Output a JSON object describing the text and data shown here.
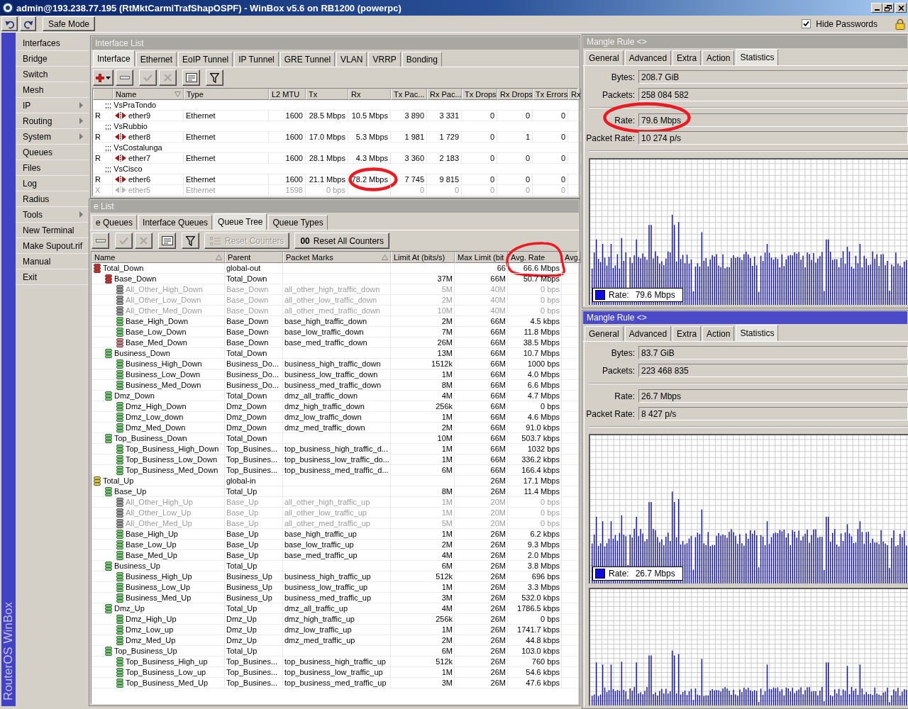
{
  "window": {
    "title": "admin@193.238.77.195 (RtMktCarmiTrafShapOSPF) - WinBox v5.6 on RB1200 (powerpc)"
  },
  "toolbar": {
    "safe_mode": "Safe Mode",
    "hide_passwords": {
      "label": "Hide Passwords",
      "checked": true
    }
  },
  "brand": "RouterOS WinBox",
  "sidebar": {
    "items": [
      {
        "label": "Interfaces",
        "submenu": false
      },
      {
        "label": "Bridge",
        "submenu": false
      },
      {
        "label": "Switch",
        "submenu": false
      },
      {
        "label": "Mesh",
        "submenu": false
      },
      {
        "label": "IP",
        "submenu": true
      },
      {
        "label": "Routing",
        "submenu": true
      },
      {
        "label": "System",
        "submenu": true
      },
      {
        "label": "Queues",
        "submenu": false
      },
      {
        "label": "Files",
        "submenu": false
      },
      {
        "label": "Log",
        "submenu": false
      },
      {
        "label": "Radius",
        "submenu": false
      },
      {
        "label": "Tools",
        "submenu": true
      },
      {
        "label": "New Terminal",
        "submenu": false
      },
      {
        "label": "Make Supout.rif",
        "submenu": false
      },
      {
        "label": "Manual",
        "submenu": false
      },
      {
        "label": "Exit",
        "submenu": false
      }
    ]
  },
  "interface_list": {
    "title": "Interface List",
    "tabs": [
      {
        "label": "Interface",
        "selected": true
      },
      {
        "label": "Ethernet",
        "selected": false
      },
      {
        "label": "EoIP Tunnel",
        "selected": false
      },
      {
        "label": "IP Tunnel",
        "selected": false
      },
      {
        "label": "GRE Tunnel",
        "selected": false
      },
      {
        "label": "VLAN",
        "selected": false
      },
      {
        "label": "VRRP",
        "selected": false
      },
      {
        "label": "Bonding",
        "selected": false
      }
    ],
    "tools": [
      {
        "kind": "add",
        "disabled": false
      },
      {
        "kind": "remove",
        "disabled": false
      },
      {
        "kind": "enable",
        "disabled": true
      },
      {
        "kind": "disable",
        "disabled": true
      },
      {
        "kind": "comment",
        "disabled": false
      },
      {
        "kind": "filter",
        "disabled": false
      }
    ],
    "columns": [
      {
        "label": "Name",
        "sorted": true,
        "descending": true
      },
      {
        "label": "Type"
      },
      {
        "label": "L2 MTU"
      },
      {
        "label": "Tx"
      },
      {
        "label": "Rx"
      },
      {
        "label": "Tx Pac..."
      },
      {
        "label": "Rx Pac..."
      },
      {
        "label": "Tx Drops"
      },
      {
        "label": "Rx Drops"
      },
      {
        "label": "Tx Errors"
      },
      {
        "label": "Rx"
      }
    ],
    "rows": [
      {
        "kind": "comment",
        "text": ";;; VsPraTondo"
      },
      {
        "kind": "interface",
        "flag": "R",
        "name": "ether9",
        "type": "Ethernet",
        "l2_mtu": "1600",
        "tx": "28.5 Mbps",
        "rx": "10.5 Mbps",
        "tx_packets": "3 890",
        "rx_packets": "3 331",
        "tx_drops": "0",
        "rx_drops": "0",
        "tx_errors": "0",
        "disabled": false
      },
      {
        "kind": "comment",
        "text": ";;; VsRubbio"
      },
      {
        "kind": "interface",
        "flag": "R",
        "name": "ether8",
        "type": "Ethernet",
        "l2_mtu": "1600",
        "tx": "17.0 Mbps",
        "rx": "5.3 Mbps",
        "tx_packets": "1 981",
        "rx_packets": "1 729",
        "tx_drops": "0",
        "rx_drops": "1",
        "tx_errors": "0",
        "disabled": false
      },
      {
        "kind": "comment",
        "text": ";;; VsCostalunga"
      },
      {
        "kind": "interface",
        "flag": "R",
        "name": "ether7",
        "type": "Ethernet",
        "l2_mtu": "1600",
        "tx": "28.1 Mbps",
        "rx": "4.3 Mbps",
        "tx_packets": "3 360",
        "rx_packets": "2 183",
        "tx_drops": "0",
        "rx_drops": "0",
        "tx_errors": "0",
        "disabled": false
      },
      {
        "kind": "comment",
        "text": ";;; VsCisco"
      },
      {
        "kind": "interface",
        "flag": "R",
        "name": "ether6",
        "type": "Ethernet",
        "l2_mtu": "1600",
        "tx": "21.1 Mbps",
        "rx": "78.2 Mbps",
        "tx_packets": "7 745",
        "rx_packets": "9 815",
        "tx_drops": "0",
        "rx_drops": "0",
        "tx_errors": "0",
        "disabled": false,
        "circled": true
      },
      {
        "kind": "interface",
        "flag": "X",
        "name": "ether5",
        "type": "Ethernet",
        "l2_mtu": "1598",
        "tx": "0 bps",
        "tx_packets": "0",
        "rx_packets": "0",
        "tx_drops": "0",
        "rx_drops": "0",
        "tx_errors": "0",
        "disabled": true
      }
    ]
  },
  "queue_list": {
    "title": "e List",
    "tabs": [
      {
        "label": "e Queues",
        "selected": false
      },
      {
        "label": "Interface Queues",
        "selected": false
      },
      {
        "label": "Queue Tree",
        "selected": true
      },
      {
        "label": "Queue Types",
        "selected": false
      }
    ],
    "tools": [
      {
        "kind": "remove",
        "disabled": false
      },
      {
        "kind": "enable",
        "disabled": true
      },
      {
        "kind": "disable",
        "disabled": true
      },
      {
        "kind": "comment",
        "disabled": false
      },
      {
        "kind": "filter",
        "disabled": false
      }
    ],
    "buttons": [
      {
        "kind": "reset_counters",
        "label": "Reset Counters",
        "disabled": true
      },
      {
        "kind": "reset_all_counters",
        "icon_text": "00",
        "label": "Reset All Counters",
        "disabled": false
      }
    ],
    "columns": [
      {
        "label": "Name",
        "sorted": true,
        "descending": false
      },
      {
        "label": "Parent"
      },
      {
        "label": "Packet Marks",
        "sorted": true,
        "descending": false
      },
      {
        "label": "Limit At (bits/s)"
      },
      {
        "label": "Max Limit (bit"
      },
      {
        "label": "Avg. Rate",
        "circled": true
      },
      {
        "label": "Avg."
      }
    ],
    "rows": [
      {
        "name": "Total_Down",
        "parent": "global-out",
        "max_limit": "66",
        "avg_rate": "66.6 Mbps",
        "color": "#e02828",
        "disabled": false,
        "children": [
          {
            "name": "Base_Down",
            "parent": "Total_Down",
            "limit_at": "37M",
            "max_limit": "66M",
            "avg_rate": "50.7 Mbps",
            "color": "#e02828",
            "disabled": false,
            "children": [
              {
                "name": "All_Other_High_Down",
                "parent": "Base_Down",
                "packet_marks": "all_other_high_traffic_down",
                "limit_at": "5M",
                "max_limit": "40M",
                "avg_rate": "0 bps",
                "color": "#a0a0a0",
                "disabled": true
              },
              {
                "name": "All_Other_Low_Down",
                "parent": "Base_Down",
                "packet_marks": "all_other_low_traffic_down",
                "limit_at": "2M",
                "max_limit": "40M",
                "avg_rate": "0 bps",
                "color": "#a0a0a0",
                "disabled": true
              },
              {
                "name": "All_Other_Med_Down",
                "parent": "Base_Down",
                "packet_marks": "all_other_med_traffic_down",
                "limit_at": "10M",
                "max_limit": "40M",
                "avg_rate": "0 bps",
                "color": "#a0a0a0",
                "disabled": true
              },
              {
                "name": "Base_High_Down",
                "parent": "Base_Down",
                "packet_marks": "base_high_traffic_down",
                "limit_at": "2M",
                "max_limit": "66M",
                "avg_rate": "4.5 kbps",
                "color": "#6cd86c",
                "disabled": false
              },
              {
                "name": "Base_Low_Down",
                "parent": "Base_Down",
                "packet_marks": "base_low_traffic_down",
                "limit_at": "7M",
                "max_limit": "66M",
                "avg_rate": "11.8 Mbps",
                "color": "#6cd86c",
                "disabled": false
              },
              {
                "name": "Base_Med_Down",
                "parent": "Base_Down",
                "packet_marks": "base_med_traffic_down",
                "limit_at": "26M",
                "max_limit": "66M",
                "avg_rate": "38.5 Mbps",
                "color": "#d88a8a",
                "disabled": false
              }
            ]
          },
          {
            "name": "Business_Down",
            "parent": "Total_Down",
            "limit_at": "13M",
            "max_limit": "66M",
            "avg_rate": "10.7 Mbps",
            "color": "#6cd86c",
            "disabled": false,
            "children": [
              {
                "name": "Business_High_Down",
                "parent": "Business_Do...",
                "packet_marks": "business_high_traffic_down",
                "limit_at": "1512k",
                "max_limit": "66M",
                "avg_rate": "1000 bps",
                "color": "#6cd86c",
                "disabled": false
              },
              {
                "name": "Business_Low_Down",
                "parent": "Business_Do...",
                "packet_marks": "business_low_traffic_down",
                "limit_at": "1M",
                "max_limit": "66M",
                "avg_rate": "4.0 Mbps",
                "color": "#6cd86c",
                "disabled": false
              },
              {
                "name": "Business_Med_Down",
                "parent": "Business_Do...",
                "packet_marks": "business_med_traffic_down",
                "limit_at": "8M",
                "max_limit": "66M",
                "avg_rate": "6.6 Mbps",
                "color": "#6cd86c",
                "disabled": false
              }
            ]
          },
          {
            "name": "Dmz_Down",
            "parent": "Total_Down",
            "packet_marks": "dmz_all_traffic_down",
            "limit_at": "4M",
            "max_limit": "66M",
            "avg_rate": "4.7 Mbps",
            "color": "#6cd86c",
            "disabled": false,
            "children": [
              {
                "name": "Dmz_High_Down",
                "parent": "Dmz_Down",
                "packet_marks": "dmz_high_traffic_down",
                "limit_at": "256k",
                "max_limit": "66M",
                "avg_rate": "0 bps",
                "color": "#6cd86c",
                "disabled": false
              },
              {
                "name": "Dmz_Low_down",
                "parent": "Dmz_Down",
                "packet_marks": "dmz_low_traffic_down",
                "limit_at": "1M",
                "max_limit": "66M",
                "avg_rate": "4.6 Mbps",
                "color": "#6cd86c",
                "disabled": false
              },
              {
                "name": "Dmz_Med_Down",
                "parent": "Dmz_Down",
                "packet_marks": "dmz_med_traffic_down",
                "limit_at": "2M",
                "max_limit": "66M",
                "avg_rate": "91.0 kbps",
                "color": "#6cd86c",
                "disabled": false
              }
            ]
          },
          {
            "name": "Top_Business_Down",
            "parent": "Total_Down",
            "limit_at": "10M",
            "max_limit": "66M",
            "avg_rate": "503.7 kbps",
            "color": "#6cd86c",
            "disabled": false,
            "children": [
              {
                "name": "Top_Business_High_Down",
                "parent": "Top_Busines...",
                "packet_marks": "top_business_high_traffic_d...",
                "limit_at": "1M",
                "max_limit": "66M",
                "avg_rate": "1032 bps",
                "color": "#6cd86c",
                "disabled": false
              },
              {
                "name": "Top_Business_Low_Down",
                "parent": "Top_Busines...",
                "packet_marks": "top_business_low_traffic_do...",
                "limit_at": "1M",
                "max_limit": "66M",
                "avg_rate": "336.2 kbps",
                "color": "#6cd86c",
                "disabled": false
              },
              {
                "name": "Top_Business_Med_Down",
                "parent": "Top_Busines...",
                "packet_marks": "top_business_med_traffic_d...",
                "limit_at": "6M",
                "max_limit": "66M",
                "avg_rate": "166.4 kbps",
                "color": "#6cd86c",
                "disabled": false
              }
            ]
          }
        ]
      },
      {
        "name": "Total_Up",
        "parent": "global-in",
        "max_limit": "26M",
        "avg_rate": "17.1 Mbps",
        "color": "#e8d23c",
        "disabled": false,
        "children": [
          {
            "name": "Base_Up",
            "parent": "Total_Up",
            "limit_at": "8M",
            "max_limit": "26M",
            "avg_rate": "11.4 Mbps",
            "color": "#6cd86c",
            "disabled": false,
            "children": [
              {
                "name": "All_Other_High_Up",
                "parent": "Base_Up",
                "packet_marks": "all_other_high_traffic_up",
                "limit_at": "1M",
                "max_limit": "20M",
                "avg_rate": "0 bps",
                "color": "#a0a0a0",
                "disabled": true
              },
              {
                "name": "All_Other_Low_Up",
                "parent": "Base_Up",
                "packet_marks": "all_other_low_traffic_up",
                "limit_at": "1M",
                "max_limit": "20M",
                "avg_rate": "0 bps",
                "color": "#a0a0a0",
                "disabled": true
              },
              {
                "name": "All_Other_Med_Up",
                "parent": "Base_Up",
                "packet_marks": "all_other_med_traffic_up",
                "limit_at": "5M",
                "max_limit": "20M",
                "avg_rate": "0 bps",
                "color": "#a0a0a0",
                "disabled": true
              },
              {
                "name": "Base_High_Up",
                "parent": "Base_Up",
                "packet_marks": "base_high_traffic_up",
                "limit_at": "1M",
                "max_limit": "26M",
                "avg_rate": "6.2 kbps",
                "color": "#6cd86c",
                "disabled": false
              },
              {
                "name": "Base_Low_Up",
                "parent": "Base_Up",
                "packet_marks": "base_low_traffic_up",
                "limit_at": "2M",
                "max_limit": "26M",
                "avg_rate": "9.3 Mbps",
                "color": "#6cd86c",
                "disabled": false
              },
              {
                "name": "Base_Med_Up",
                "parent": "Base_Up",
                "packet_marks": "base_med_traffic_up",
                "limit_at": "4M",
                "max_limit": "26M",
                "avg_rate": "2.0 Mbps",
                "color": "#6cd86c",
                "disabled": false
              }
            ]
          },
          {
            "name": "Business_Up",
            "parent": "Total_Up",
            "limit_at": "6M",
            "max_limit": "26M",
            "avg_rate": "3.8 Mbps",
            "color": "#6cd86c",
            "disabled": false,
            "children": [
              {
                "name": "Business_High_Up",
                "parent": "Business_Up",
                "packet_marks": "business_high_traffic_up",
                "limit_at": "512k",
                "max_limit": "26M",
                "avg_rate": "696 bps",
                "color": "#6cd86c",
                "disabled": false
              },
              {
                "name": "Business_Low_Up",
                "parent": "Business_Up",
                "packet_marks": "business_low_traffic_up",
                "limit_at": "1M",
                "max_limit": "26M",
                "avg_rate": "3.3 Mbps",
                "color": "#6cd86c",
                "disabled": false
              },
              {
                "name": "Business_Med_Up",
                "parent": "Business_Up",
                "packet_marks": "business_med_traffic_up",
                "limit_at": "3M",
                "max_limit": "26M",
                "avg_rate": "532.0 kbps",
                "color": "#6cd86c",
                "disabled": false
              }
            ]
          },
          {
            "name": "Dmz_Up",
            "parent": "Total_Up",
            "packet_marks": "dmz_all_traffic_up",
            "limit_at": "4M",
            "max_limit": "26M",
            "avg_rate": "1786.5 kbps",
            "color": "#6cd86c",
            "disabled": false,
            "children": [
              {
                "name": "Dmz_High_Up",
                "parent": "Dmz_Up",
                "packet_marks": "dmz_high_traffic_up",
                "limit_at": "256k",
                "max_limit": "26M",
                "avg_rate": "0 bps",
                "color": "#6cd86c",
                "disabled": false
              },
              {
                "name": "Dmz_Low_up",
                "parent": "Dmz_Up",
                "packet_marks": "dmz_low_traffic_up",
                "limit_at": "1M",
                "max_limit": "26M",
                "avg_rate": "1741.7 kbps",
                "color": "#6cd86c",
                "disabled": false
              },
              {
                "name": "Dmz_Med_Up",
                "parent": "Dmz_Up",
                "packet_marks": "dmz_med_traffic_up",
                "limit_at": "2M",
                "max_limit": "26M",
                "avg_rate": "44.8 kbps",
                "color": "#6cd86c",
                "disabled": false
              }
            ]
          },
          {
            "name": "Top_Business_Up",
            "parent": "Total_Up",
            "limit_at": "6M",
            "max_limit": "26M",
            "avg_rate": "103.0 kbps",
            "color": "#6cd86c",
            "disabled": false,
            "children": [
              {
                "name": "Top_Business_High_up",
                "parent": "Top_Busines...",
                "packet_marks": "top_business_high_traffic_up",
                "limit_at": "512k",
                "max_limit": "26M",
                "avg_rate": "760 bps",
                "color": "#6cd86c",
                "disabled": false
              },
              {
                "name": "Top_Business_Low_up",
                "parent": "Top_Busines...",
                "packet_marks": "top_business_low_traffic_up",
                "limit_at": "1M",
                "max_limit": "26M",
                "avg_rate": "54.6 kbps",
                "color": "#6cd86c",
                "disabled": false
              },
              {
                "name": "Top_Business_Med_Up",
                "parent": "Top_Busines...",
                "packet_marks": "top_business_med_traffic_up",
                "limit_at": "3M",
                "max_limit": "26M",
                "avg_rate": "47.6 kbps",
                "color": "#6cd86c",
                "disabled": false
              }
            ]
          }
        ]
      }
    ]
  },
  "mangle_rules": [
    {
      "title": "Mangle Rule <>",
      "active": false,
      "tabs": [
        {
          "label": "General",
          "selected": false
        },
        {
          "label": "Advanced",
          "selected": false
        },
        {
          "label": "Extra",
          "selected": false
        },
        {
          "label": "Action",
          "selected": false
        },
        {
          "label": "Statistics",
          "selected": true
        }
      ],
      "field_groups": [
        {
          "fields": [
            {
              "label": "Bytes:",
              "value": "208.7 GiB"
            },
            {
              "label": "Packets:",
              "value": "258 084 582"
            }
          ]
        },
        {
          "fields": [
            {
              "label": "Rate:",
              "value": "79.6 Mbps",
              "circled": true
            },
            {
              "label": "Packet Rate:",
              "value": "10 274 p/s"
            }
          ]
        }
      ],
      "graphs": [
        {
          "kind": "rate",
          "legend_label": "Rate:",
          "legend_value": "79.6 Mbps"
        }
      ]
    },
    {
      "title": "Mangle Rule <>",
      "active": true,
      "tabs": [
        {
          "label": "General",
          "selected": false
        },
        {
          "label": "Advanced",
          "selected": false
        },
        {
          "label": "Extra",
          "selected": false
        },
        {
          "label": "Action",
          "selected": false
        },
        {
          "label": "Statistics",
          "selected": true
        }
      ],
      "field_groups": [
        {
          "fields": [
            {
              "label": "Bytes:",
              "value": "83.7 GiB"
            },
            {
              "label": "Packets:",
              "value": "223 468 835"
            }
          ]
        },
        {
          "fields": [
            {
              "label": "Rate:",
              "value": "26.7 Mbps"
            },
            {
              "label": "Packet Rate:",
              "value": "8 427 p/s"
            }
          ]
        }
      ],
      "graphs": [
        {
          "kind": "rate",
          "legend_label": "Rate:",
          "legend_value": "26.7 Mbps"
        },
        {
          "kind": "packet_rate"
        }
      ]
    }
  ]
}
